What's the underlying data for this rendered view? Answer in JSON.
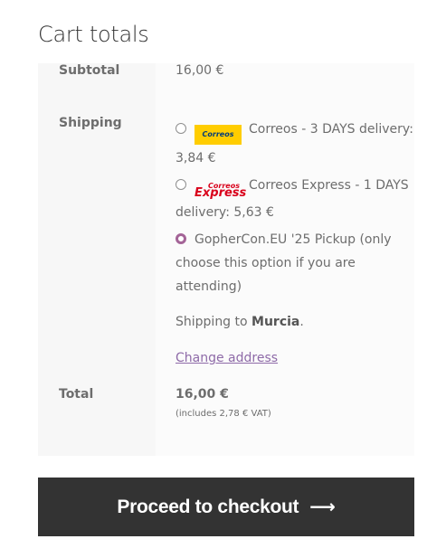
{
  "cart": {
    "title": "Cart totals",
    "subtotal_label": "Subtotal",
    "subtotal_value": "16,00 €",
    "shipping_label": "Shipping",
    "shipping_options": [
      {
        "logo": "correos-logo",
        "logo_text": "Correos",
        "text": "Correos - 3 DAYS delivery: 3,84 €",
        "selected": false
      },
      {
        "logo": "correos-express-logo",
        "logo_text_top": "Correos",
        "logo_text_bottom": "Express",
        "text": "Correos Express - 1 DAYS delivery: 5,63 €",
        "selected": false
      },
      {
        "logo": null,
        "text": "GopherCon.EU '25 Pickup (only choose this option if you are attending)",
        "selected": true
      }
    ],
    "shipping_to_prefix": "Shipping to",
    "shipping_to_place": "Murcia",
    "change_address": "Change address",
    "total_label": "Total",
    "total_value": "16,00 €",
    "vat_note": "(includes 2,78 € VAT)",
    "checkout_label": "Proceed to checkout",
    "checkout_arrow": "⟶"
  },
  "colors": {
    "button_bg": "#333333",
    "radio_selected": "#a46497",
    "link": "#8e6aa8",
    "correos_yellow": "#ffcd00",
    "express_red": "#d9001b"
  }
}
